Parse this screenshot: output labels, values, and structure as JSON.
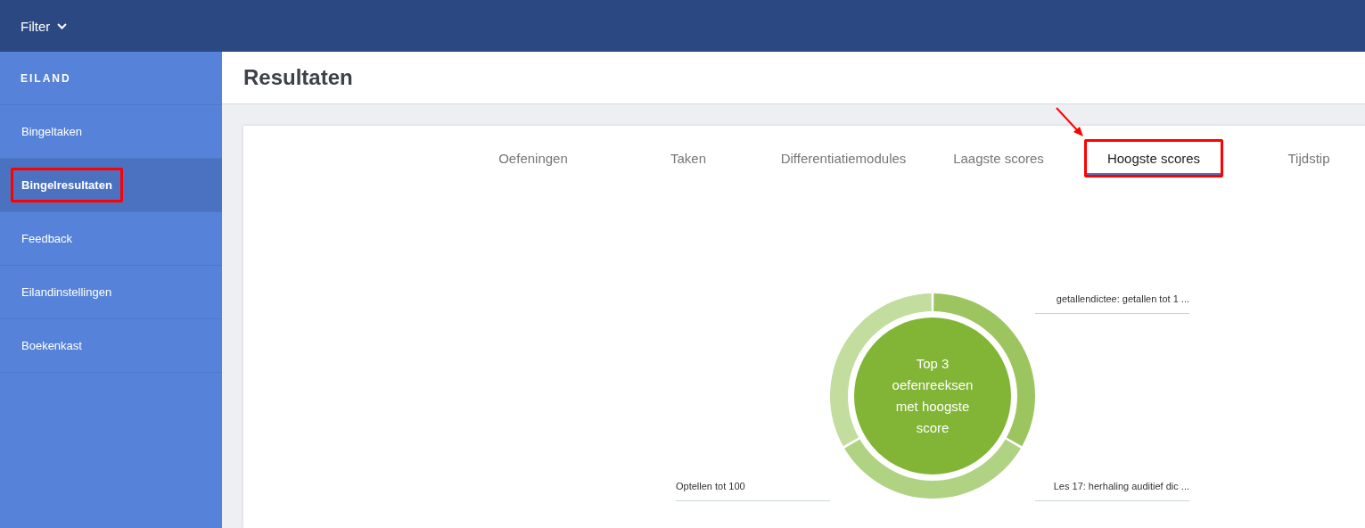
{
  "topbar": {
    "filter_label": "Filter"
  },
  "sidebar": {
    "heading": "EILAND",
    "items": [
      {
        "label": "Bingeltaken",
        "selected": false,
        "highlighted": false
      },
      {
        "label": "Bingelresultaten",
        "selected": true,
        "highlighted": true
      },
      {
        "label": "Feedback",
        "selected": false,
        "highlighted": false
      },
      {
        "label": "Eilandinstellingen",
        "selected": false,
        "highlighted": false
      },
      {
        "label": "Boekenkast",
        "selected": false,
        "highlighted": false
      }
    ]
  },
  "page": {
    "title": "Resultaten"
  },
  "tabs": [
    {
      "label": "Oefeningen",
      "selected": false,
      "highlighted": false
    },
    {
      "label": "Taken",
      "selected": false,
      "highlighted": false
    },
    {
      "label": "Differentiatiemodules",
      "selected": false,
      "highlighted": false
    },
    {
      "label": "Laagste scores",
      "selected": false,
      "highlighted": false
    },
    {
      "label": "Hoogste scores",
      "selected": true,
      "highlighted": true
    },
    {
      "label": "Tijdstip",
      "selected": false,
      "highlighted": false
    }
  ],
  "donut": {
    "center_text": "Top 3 oefenreeksen met hoogste score",
    "segments": [
      {
        "label": "getallendictee: getallen tot 1 ...",
        "color": "#9dc55f"
      },
      {
        "label": "Optellen tot 100",
        "color": "#c3dd9f"
      },
      {
        "label": "Les 17: herhaling auditief dic ...",
        "color": "#b0d383"
      }
    ]
  }
}
